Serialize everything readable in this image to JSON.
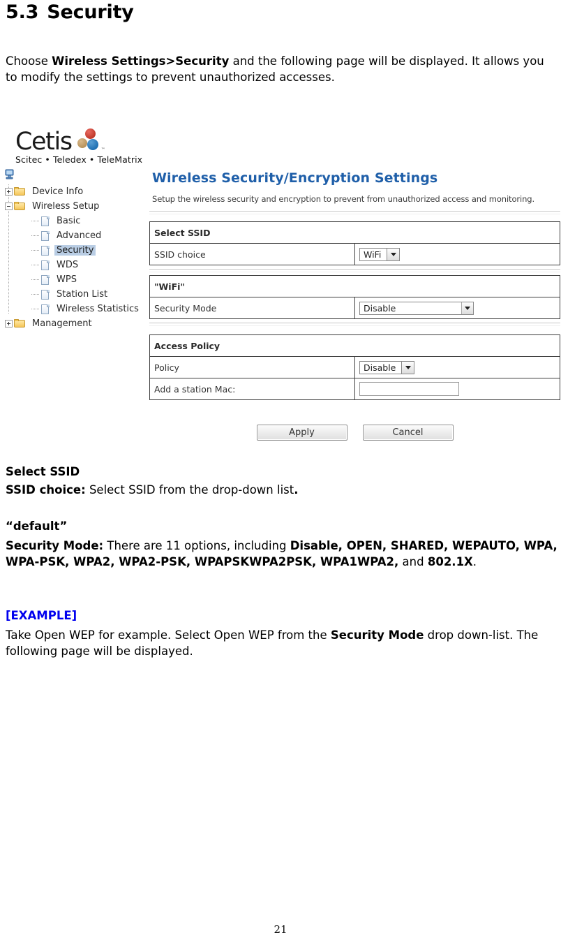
{
  "document": {
    "section_number": "5.3",
    "section_title": "Security",
    "intro": {
      "part1": "Choose ",
      "bold1": "Wireless Settings>Security",
      "part2": " and the following page will be displayed. It allows you to modify the settings to prevent unauthorized accesses."
    },
    "select_ssid_heading": "Select SSID",
    "ssid_choice_label": "SSID choice:",
    "ssid_choice_text": " Select SSID from the drop-down list",
    "ssid_choice_period": ".",
    "default_heading": "“default”",
    "security_mode_label": "Security Mode:",
    "security_mode_intro": " There are 11 options, including ",
    "security_mode_options_bold": "Disable, OPEN, SHARED, WEPAUTO, WPA, WPA-PSK, WPA2, WPA2-PSK, WPAPSKWPA2PSK, WPA1WPA2,",
    "security_mode_and": " and ",
    "security_mode_last_bold": "802.1X",
    "security_mode_end": ".",
    "example_heading": "[EXAMPLE]",
    "example_part1": "Take Open WEP for example. Select Open WEP from the ",
    "example_bold": "Security Mode",
    "example_part2": " drop down-list. The following page will be displayed.",
    "page_number": "21"
  },
  "router_ui": {
    "logo": {
      "wordmark": "Cetis",
      "trademark": "™",
      "tagline": "Scitec • Teledex • TeleMatrix"
    },
    "tree": {
      "root_icon": "computer-icon",
      "items": [
        {
          "label": "Device Info",
          "type": "folder",
          "expander": "plus",
          "level": 1,
          "selected": false
        },
        {
          "label": "Wireless Setup",
          "type": "folder",
          "expander": "minus",
          "level": 1,
          "selected": false
        },
        {
          "label": "Basic",
          "type": "page",
          "expander": "none",
          "level": 2,
          "selected": false
        },
        {
          "label": "Advanced",
          "type": "page",
          "expander": "none",
          "level": 2,
          "selected": false
        },
        {
          "label": "Security",
          "type": "page",
          "expander": "none",
          "level": 2,
          "selected": true
        },
        {
          "label": "WDS",
          "type": "page",
          "expander": "none",
          "level": 2,
          "selected": false
        },
        {
          "label": "WPS",
          "type": "page",
          "expander": "none",
          "level": 2,
          "selected": false
        },
        {
          "label": "Station List",
          "type": "page",
          "expander": "none",
          "level": 2,
          "selected": false
        },
        {
          "label": "Wireless Statistics",
          "type": "page",
          "expander": "none",
          "level": 2,
          "selected": false
        },
        {
          "label": "Management",
          "type": "folder",
          "expander": "plus",
          "level": 1,
          "selected": false
        }
      ]
    },
    "panel": {
      "title": "Wireless Security/Encryption Settings",
      "title_color": "#1f5fa9",
      "subtitle": "Setup the wireless security and encryption to prevent from unauthorized access and monitoring."
    },
    "select_ssid_section": {
      "header": "Select SSID",
      "ssid_choice_label": "SSID choice",
      "ssid_choice_value": "WiFi"
    },
    "wifi_section": {
      "header": "\"WiFi\"",
      "security_mode_label": "Security Mode",
      "security_mode_value": "Disable"
    },
    "access_policy_section": {
      "header": "Access Policy",
      "policy_label": "Policy",
      "policy_value": "Disable",
      "station_mac_label": "Add a station Mac:",
      "station_mac_value": ""
    },
    "buttons": {
      "apply": "Apply",
      "cancel": "Cancel"
    }
  }
}
